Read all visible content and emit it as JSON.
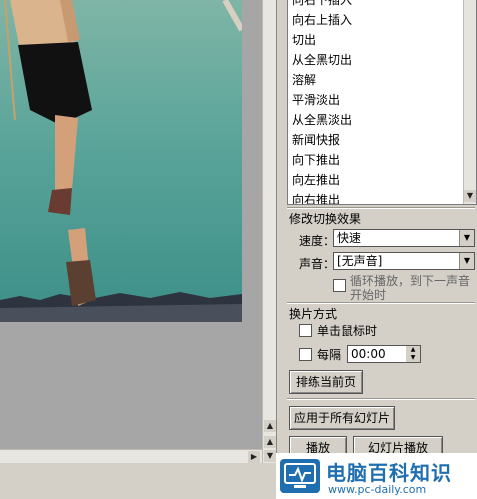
{
  "transitions": {
    "items": [
      "向右下插入",
      "向右上插入",
      "切出",
      "从全黑切出",
      "溶解",
      "平滑淡出",
      "从全黑淡出",
      "新闻快报",
      "向下推出",
      "向左推出",
      "向右推出"
    ]
  },
  "modify": {
    "title": "修改切换效果",
    "speed_label": "速度：",
    "speed_value": "快速",
    "sound_label": "声音：",
    "sound_value": "[无声音]",
    "loop_text": "循环播放，到下一声音开始时"
  },
  "advance": {
    "title": "换片方式",
    "on_click": "单击鼠标时",
    "every": "每隔",
    "time_value": "00:00"
  },
  "buttons": {
    "rehearse": "排练当前页",
    "apply_all": "应用于所有幻灯片",
    "play": "播放",
    "slideshow": "幻灯片播放"
  },
  "watermark": {
    "title": "电脑百科知识",
    "url": "www.pc-daily.com"
  }
}
